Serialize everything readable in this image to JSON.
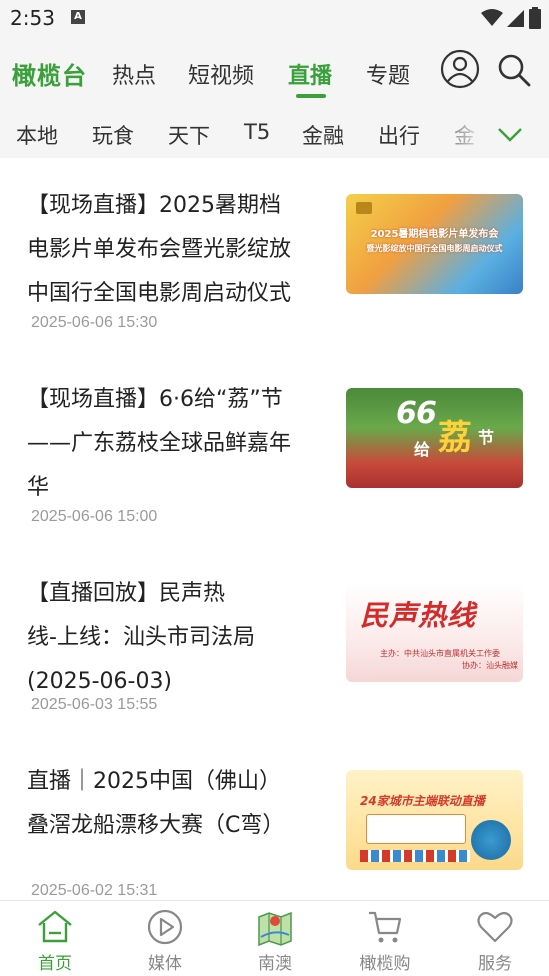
{
  "status_bar": {
    "time": "2:53"
  },
  "header": {
    "logo": "橄榄台",
    "tabs": [
      {
        "label": "热点"
      },
      {
        "label": "短视频"
      },
      {
        "label": "直播"
      },
      {
        "label": "专题"
      }
    ],
    "active_tab": "直播"
  },
  "categories": [
    "本地",
    "玩食",
    "天下",
    "T5",
    "金融",
    "出行",
    "金"
  ],
  "feed": [
    {
      "title_lines": [
        "【现场直播】2025暑期档",
        "电影片单发布会暨光影绽放",
        "中国行全国电影周启动仪式"
      ],
      "date": "2025-06-06 15:30",
      "thumb_lines": [
        "2025暑期档电影片单发布会",
        "暨光影绽放中国行全国电影周启动仪式"
      ]
    },
    {
      "title_lines": [
        "【现场直播】6·6给“荔”节",
        "——广东荔枝全球品鲜嘉年",
        "华"
      ],
      "date": "2025-06-06 15:00",
      "thumb_lines": [
        "6",
        "6",
        "给",
        "荔",
        "节"
      ]
    },
    {
      "title_lines": [
        "【直播回放】民声热",
        "线-上线：汕头市司法局",
        "(2025-06-03)"
      ],
      "date": "2025-06-03 15:55",
      "thumb_lines": [
        "民声热线",
        "主办：中共汕头市直属机关工作委",
        "协办：汕头融媒"
      ]
    },
    {
      "title_lines": [
        "直播｜2025中国（佛山）",
        "叠滘龙船漂移大赛（C弯）"
      ],
      "date": "2025-06-02 15:31",
      "thumb_lines": [
        "24家城市主端联动直播"
      ]
    }
  ],
  "bottom_nav": [
    {
      "label": "首页",
      "icon": "home-icon",
      "active": true
    },
    {
      "label": "媒体",
      "icon": "play-icon",
      "active": false
    },
    {
      "label": "南澳",
      "icon": "map-icon",
      "active": false
    },
    {
      "label": "橄榄购",
      "icon": "cart-icon",
      "active": false
    },
    {
      "label": "服务",
      "icon": "heart-icon",
      "active": false
    }
  ],
  "colors": {
    "accent": "#3aa03a",
    "text": "#222222",
    "muted": "#9a9a9a",
    "header_bg": "#f5f5f5"
  }
}
